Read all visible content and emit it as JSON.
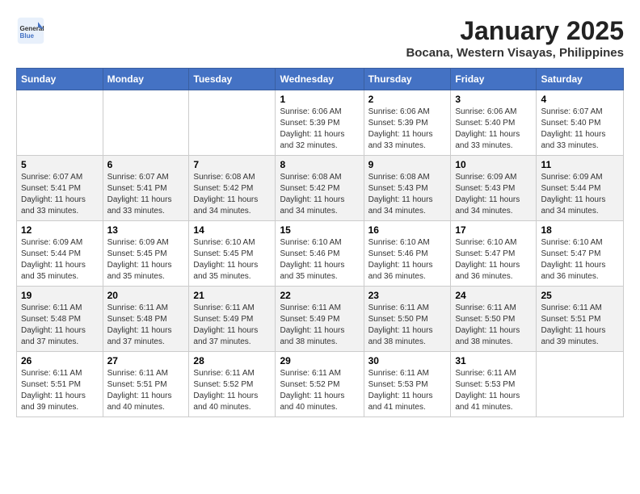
{
  "logo": {
    "general": "General",
    "blue": "Blue"
  },
  "title": "January 2025",
  "location": "Bocana, Western Visayas, Philippines",
  "days_of_week": [
    "Sunday",
    "Monday",
    "Tuesday",
    "Wednesday",
    "Thursday",
    "Friday",
    "Saturday"
  ],
  "weeks": [
    [
      {
        "num": "",
        "info": ""
      },
      {
        "num": "",
        "info": ""
      },
      {
        "num": "",
        "info": ""
      },
      {
        "num": "1",
        "info": "Sunrise: 6:06 AM\nSunset: 5:39 PM\nDaylight: 11 hours\nand 32 minutes."
      },
      {
        "num": "2",
        "info": "Sunrise: 6:06 AM\nSunset: 5:39 PM\nDaylight: 11 hours\nand 33 minutes."
      },
      {
        "num": "3",
        "info": "Sunrise: 6:06 AM\nSunset: 5:40 PM\nDaylight: 11 hours\nand 33 minutes."
      },
      {
        "num": "4",
        "info": "Sunrise: 6:07 AM\nSunset: 5:40 PM\nDaylight: 11 hours\nand 33 minutes."
      }
    ],
    [
      {
        "num": "5",
        "info": "Sunrise: 6:07 AM\nSunset: 5:41 PM\nDaylight: 11 hours\nand 33 minutes."
      },
      {
        "num": "6",
        "info": "Sunrise: 6:07 AM\nSunset: 5:41 PM\nDaylight: 11 hours\nand 33 minutes."
      },
      {
        "num": "7",
        "info": "Sunrise: 6:08 AM\nSunset: 5:42 PM\nDaylight: 11 hours\nand 34 minutes."
      },
      {
        "num": "8",
        "info": "Sunrise: 6:08 AM\nSunset: 5:42 PM\nDaylight: 11 hours\nand 34 minutes."
      },
      {
        "num": "9",
        "info": "Sunrise: 6:08 AM\nSunset: 5:43 PM\nDaylight: 11 hours\nand 34 minutes."
      },
      {
        "num": "10",
        "info": "Sunrise: 6:09 AM\nSunset: 5:43 PM\nDaylight: 11 hours\nand 34 minutes."
      },
      {
        "num": "11",
        "info": "Sunrise: 6:09 AM\nSunset: 5:44 PM\nDaylight: 11 hours\nand 34 minutes."
      }
    ],
    [
      {
        "num": "12",
        "info": "Sunrise: 6:09 AM\nSunset: 5:44 PM\nDaylight: 11 hours\nand 35 minutes."
      },
      {
        "num": "13",
        "info": "Sunrise: 6:09 AM\nSunset: 5:45 PM\nDaylight: 11 hours\nand 35 minutes."
      },
      {
        "num": "14",
        "info": "Sunrise: 6:10 AM\nSunset: 5:45 PM\nDaylight: 11 hours\nand 35 minutes."
      },
      {
        "num": "15",
        "info": "Sunrise: 6:10 AM\nSunset: 5:46 PM\nDaylight: 11 hours\nand 35 minutes."
      },
      {
        "num": "16",
        "info": "Sunrise: 6:10 AM\nSunset: 5:46 PM\nDaylight: 11 hours\nand 36 minutes."
      },
      {
        "num": "17",
        "info": "Sunrise: 6:10 AM\nSunset: 5:47 PM\nDaylight: 11 hours\nand 36 minutes."
      },
      {
        "num": "18",
        "info": "Sunrise: 6:10 AM\nSunset: 5:47 PM\nDaylight: 11 hours\nand 36 minutes."
      }
    ],
    [
      {
        "num": "19",
        "info": "Sunrise: 6:11 AM\nSunset: 5:48 PM\nDaylight: 11 hours\nand 37 minutes."
      },
      {
        "num": "20",
        "info": "Sunrise: 6:11 AM\nSunset: 5:48 PM\nDaylight: 11 hours\nand 37 minutes."
      },
      {
        "num": "21",
        "info": "Sunrise: 6:11 AM\nSunset: 5:49 PM\nDaylight: 11 hours\nand 37 minutes."
      },
      {
        "num": "22",
        "info": "Sunrise: 6:11 AM\nSunset: 5:49 PM\nDaylight: 11 hours\nand 38 minutes."
      },
      {
        "num": "23",
        "info": "Sunrise: 6:11 AM\nSunset: 5:50 PM\nDaylight: 11 hours\nand 38 minutes."
      },
      {
        "num": "24",
        "info": "Sunrise: 6:11 AM\nSunset: 5:50 PM\nDaylight: 11 hours\nand 38 minutes."
      },
      {
        "num": "25",
        "info": "Sunrise: 6:11 AM\nSunset: 5:51 PM\nDaylight: 11 hours\nand 39 minutes."
      }
    ],
    [
      {
        "num": "26",
        "info": "Sunrise: 6:11 AM\nSunset: 5:51 PM\nDaylight: 11 hours\nand 39 minutes."
      },
      {
        "num": "27",
        "info": "Sunrise: 6:11 AM\nSunset: 5:51 PM\nDaylight: 11 hours\nand 40 minutes."
      },
      {
        "num": "28",
        "info": "Sunrise: 6:11 AM\nSunset: 5:52 PM\nDaylight: 11 hours\nand 40 minutes."
      },
      {
        "num": "29",
        "info": "Sunrise: 6:11 AM\nSunset: 5:52 PM\nDaylight: 11 hours\nand 40 minutes."
      },
      {
        "num": "30",
        "info": "Sunrise: 6:11 AM\nSunset: 5:53 PM\nDaylight: 11 hours\nand 41 minutes."
      },
      {
        "num": "31",
        "info": "Sunrise: 6:11 AM\nSunset: 5:53 PM\nDaylight: 11 hours\nand 41 minutes."
      },
      {
        "num": "",
        "info": ""
      }
    ]
  ]
}
